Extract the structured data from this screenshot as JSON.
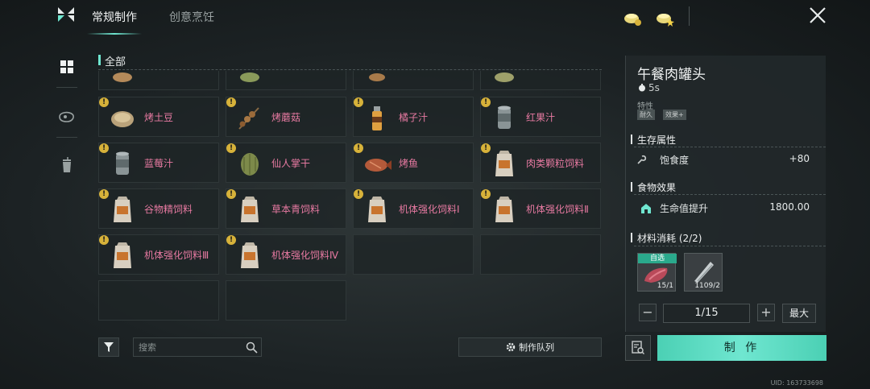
{
  "header": {
    "tabs": [
      {
        "label": "常规制作",
        "active": true
      },
      {
        "label": "创意烹饪",
        "active": false
      }
    ],
    "accent_color": "#6fe6d0"
  },
  "sidebar": {
    "items": [
      "grid-icon",
      "meat-icon",
      "drink-icon"
    ]
  },
  "list": {
    "section_title": "全部",
    "rows": [
      [
        {
          "name": "",
          "icon": "roasted-melon"
        },
        {
          "name": "",
          "icon": "grilled-vegetable"
        },
        {
          "name": "",
          "icon": "grilled-meat"
        },
        {
          "name": "",
          "icon": "roasted-fish"
        }
      ],
      [
        {
          "name": "烤土豆",
          "icon": "potato"
        },
        {
          "name": "烤蘑菇",
          "icon": "skewer"
        },
        {
          "name": "橘子汁",
          "icon": "juice-bottle"
        },
        {
          "name": "红果汁",
          "icon": "can"
        }
      ],
      [
        {
          "name": "蓝莓汁",
          "icon": "can"
        },
        {
          "name": "仙人掌干",
          "icon": "cactus"
        },
        {
          "name": "烤鱼",
          "icon": "fish"
        },
        {
          "name": "肉类颗粒饲料",
          "icon": "feed-bag"
        }
      ],
      [
        {
          "name": "谷物精饲料",
          "icon": "feed-bag"
        },
        {
          "name": "草本青饲料",
          "icon": "feed-bag"
        },
        {
          "name": "机体强化饲料Ⅰ",
          "icon": "feed-bag"
        },
        {
          "name": "机体强化饲料Ⅱ",
          "icon": "feed-bag"
        }
      ],
      [
        {
          "name": "机体强化饲料Ⅲ",
          "icon": "feed-bag"
        },
        {
          "name": "机体强化饲料Ⅳ",
          "icon": "feed-bag"
        },
        null,
        null
      ],
      [
        null,
        null
      ]
    ]
  },
  "search": {
    "placeholder": "搜索"
  },
  "queue_button": "制作队列",
  "detail": {
    "title": "午餐肉罐头",
    "time": "5s",
    "traits_label": "特性",
    "tags": [
      "耐久",
      "效果+"
    ],
    "survival_title": "生存属性",
    "satiety_label": "饱食度",
    "satiety_value": "+80",
    "effect_title": "食物效果",
    "effect_label": "生命值提升",
    "effect_value": "1800.00",
    "materials_title": "材料消耗 (2/2)",
    "materials": [
      {
        "count": "15/1",
        "tag": "自选"
      },
      {
        "count": "1109/2",
        "tag": ""
      }
    ],
    "quantity": "1/15",
    "max_label": "最大",
    "make_label": "制 作"
  },
  "uid": "UID: 163733698"
}
